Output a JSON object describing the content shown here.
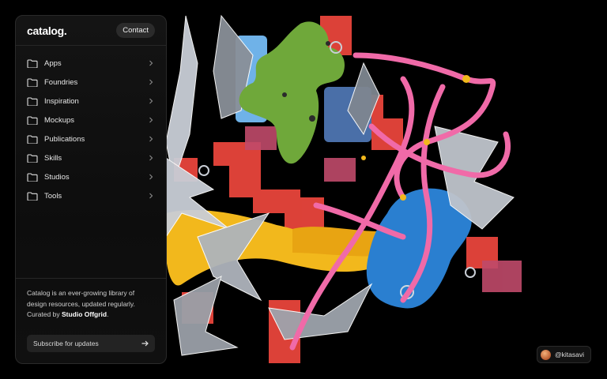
{
  "brand": {
    "logo": "catalog."
  },
  "header": {
    "contact_label": "Contact"
  },
  "nav": {
    "items": [
      {
        "label": "Apps",
        "icon": "folder-icon"
      },
      {
        "label": "Foundries",
        "icon": "folder-icon"
      },
      {
        "label": "Inspiration",
        "icon": "folder-icon"
      },
      {
        "label": "Mockups",
        "icon": "folder-icon"
      },
      {
        "label": "Publications",
        "icon": "folder-icon"
      },
      {
        "label": "Skills",
        "icon": "folder-icon"
      },
      {
        "label": "Studios",
        "icon": "folder-icon"
      },
      {
        "label": "Tools",
        "icon": "folder-icon"
      }
    ]
  },
  "footer": {
    "about_text": "Catalog is an ever-growing library of design resources, updated regularly. Curated by",
    "curator": "Studio Offgrid",
    "subscribe_label": "Subscribe for updates"
  },
  "credit": {
    "handle": "@kitasavi"
  },
  "colors": {
    "background": "#000000",
    "panel": "#121212",
    "pink": "#f06aa8",
    "green": "#6fa83a",
    "blue": "#2a7fd0",
    "yellow": "#f2b81c",
    "red": "#e8453c"
  }
}
